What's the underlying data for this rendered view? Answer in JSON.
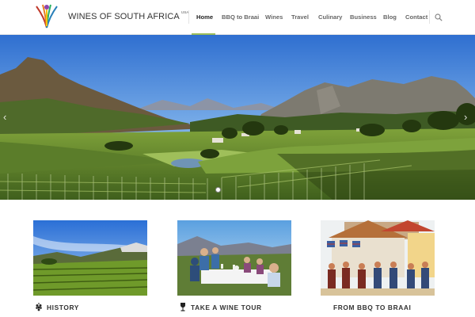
{
  "brand": {
    "name": "WINES OF SOUTH AFRICA",
    "region": "USA"
  },
  "nav": {
    "items": [
      {
        "label": "Home"
      },
      {
        "label": "BBQ to Braai"
      },
      {
        "label": "Wines"
      },
      {
        "label": "Travel"
      },
      {
        "label": "Culinary"
      },
      {
        "label": "Business"
      },
      {
        "label": "Blog"
      },
      {
        "label": "Contact"
      }
    ],
    "active": "Home",
    "search_icon": "search-icon"
  },
  "hero": {
    "prev_icon": "chevron-left-icon",
    "next_icon": "chevron-right-icon"
  },
  "cards": [
    {
      "title": "HISTORY",
      "icon": "grapes-icon"
    },
    {
      "title": "TAKE A WINE TOUR",
      "icon": "wine-glass-icon"
    },
    {
      "title": "FROM BBQ TO BRAAI",
      "icon": ""
    }
  ],
  "colors": {
    "accent": "#9bbd5a",
    "text": "#333333",
    "nav_text": "#666666"
  }
}
